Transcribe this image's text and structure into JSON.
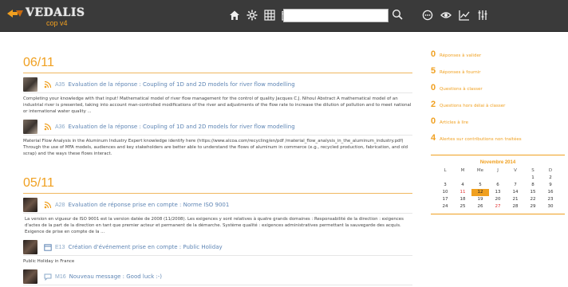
{
  "app": {
    "name": "VEDALIS",
    "subtitle": "cop v4"
  },
  "nav": {
    "icons": [
      "home-icon",
      "settings-icon",
      "grid-icon",
      "calendar-icon"
    ],
    "search_value": "",
    "right_icons": [
      "chat-icon",
      "eye-icon",
      "chart-icon",
      "sliders-icon"
    ]
  },
  "feed": [
    {
      "date": "06/11",
      "entries": [
        {
          "code": "A35",
          "title": "Evaluation de la réponse : Coupling of 1D and 2D models for river flow modelling",
          "excerpt": "Completing your knowledge with that input! Mathematical model of river flow management for the control of quality Jacques C.J. Nihoul Abstract A mathematical model of an industrial river is presented, taking into account man-controlled modifications of the river and adjustments of the flow rate to increase the dilution of pollution and to meet national or international water quality ..."
        },
        {
          "code": "A36",
          "title": "Evaluation de la réponse : Coupling of 1D and 2D models for river flow modelling",
          "excerpt": "Material Flow Analysis in the Aluminum Industry Expert knowledge identify here (https://www.alcoa.com/recycling/en/pdf /material_flow_analysis_in_the_aluminum_industry.pdf) Through the use of MFA models, audiences and key stakeholders are better able to understand the flows of aluminum in commerce (e.g., recycled production, fabrication, and old scrap) and the ways these flows interact."
        }
      ]
    },
    {
      "date": "05/11",
      "entries": [
        {
          "code": "A28",
          "title": "Evaluation de réponse prise en compte : Norme ISO 9001",
          "excerpt": "La version en vigueur de ISO 9001 est la version datée de 2008 (11/2008). Les exigences y sont relatives à quatre grands domaines : Responsabilité de la direction : exigences d'actes de la part de la direction en tant que premier acteur et permanent de la démarche. Système qualité : exigences administratives permettant la sauvegarde des acquis. Exigence de prise en compte de la ..."
        },
        {
          "code": "E13",
          "title": "Création d'événement prise en compte : Public Holiday",
          "excerpt": "Public Holiday in France"
        },
        {
          "code": "M16",
          "title": "Nouveau message : Good luck :-)",
          "excerpt": ""
        }
      ]
    }
  ],
  "stats": [
    {
      "count": "0",
      "label": "Réponses à valider"
    },
    {
      "count": "5",
      "label": "Réponses à fournir"
    },
    {
      "count": "0",
      "label": "Questions à classer"
    },
    {
      "count": "2",
      "label": "Questions hors délai à classer"
    },
    {
      "count": "0",
      "label": "Articles à lire"
    },
    {
      "count": "4",
      "label": "Alertes sur contributions non traitées"
    }
  ],
  "calendar": {
    "title": "Novembre 2014",
    "weekdays": [
      "L",
      "M",
      "Me",
      "J",
      "V",
      "S",
      "D"
    ],
    "weeks": [
      [
        "",
        "",
        "",
        "",
        "",
        "1",
        "2"
      ],
      [
        "3",
        "4",
        "5",
        "6",
        "7",
        "8",
        "9"
      ],
      [
        "10",
        "11",
        "12",
        "13",
        "14",
        "15",
        "16"
      ],
      [
        "17",
        "18",
        "19",
        "20",
        "21",
        "22",
        "23"
      ],
      [
        "24",
        "25",
        "26",
        "27",
        "28",
        "29",
        "30"
      ]
    ],
    "today": "12",
    "highlight_red": [
      "11",
      "27"
    ]
  },
  "colors": {
    "accent": "#f0a020",
    "link": "#5f86b5",
    "topbar": "#3a3a3a"
  }
}
